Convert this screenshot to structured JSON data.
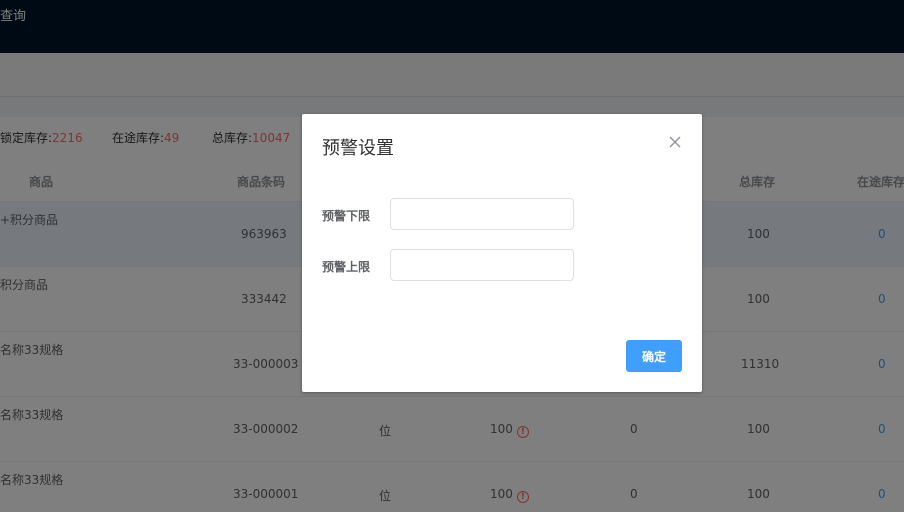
{
  "topbar": {
    "title": "查询"
  },
  "summary": {
    "locked_label": "锁定库存:",
    "locked_value": "2216",
    "transit_label": "在途库存:",
    "transit_value": "49",
    "total_label": "总库存:",
    "total_value": "10047"
  },
  "table": {
    "headers": {
      "product": "商品",
      "barcode": "商品条码",
      "total": "总库存",
      "transit": "在途库存"
    },
    "rows": [
      {
        "name": "+积分商品",
        "barcode": "963963",
        "unit": "",
        "warn_value": "",
        "locked": "",
        "total": "100",
        "transit": "0"
      },
      {
        "name": "积分商品",
        "barcode": "333442",
        "unit": "",
        "warn_value": "",
        "locked": "",
        "total": "100",
        "transit": "0"
      },
      {
        "name": "名称33规格",
        "barcode": "33-000003",
        "unit": "",
        "warn_value": "",
        "locked": "",
        "total": "11310",
        "transit": "0"
      },
      {
        "name": "名称33规格",
        "barcode": "33-000002",
        "unit": "位",
        "warn_value": "100",
        "locked": "0",
        "total": "100",
        "transit": "0"
      },
      {
        "name": "名称33规格",
        "barcode": "33-000001",
        "unit": "位",
        "warn_value": "100",
        "locked": "0",
        "total": "100",
        "transit": "0"
      }
    ]
  },
  "dialog": {
    "title": "预警设置",
    "lower_label": "预警下限",
    "upper_label": "预警上限",
    "lower_value": "",
    "upper_value": "",
    "confirm_label": "确定"
  },
  "colors": {
    "topbar": "#001529",
    "accent": "#409eff",
    "alert": "#f56c6c"
  },
  "icons": {
    "close": "close-icon",
    "warning": "warning-icon"
  }
}
